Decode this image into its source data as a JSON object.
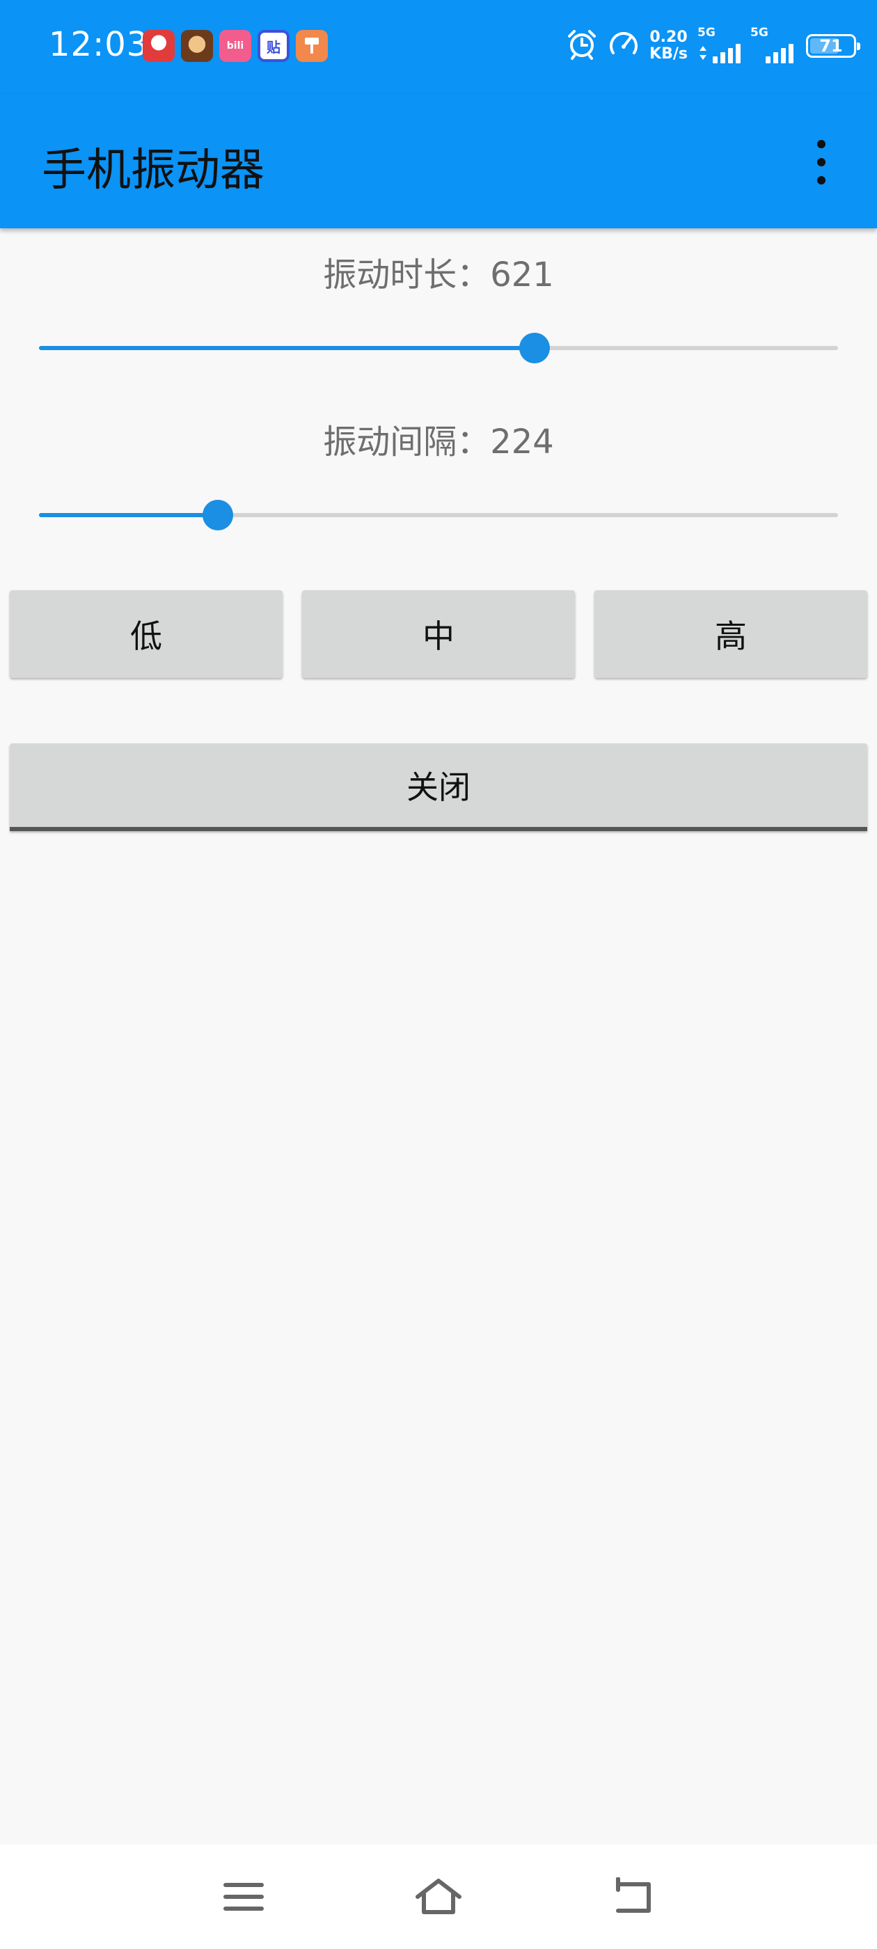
{
  "status_bar": {
    "time": "12:03",
    "notification_icons": [
      "game-app-icon",
      "hero-game-icon",
      "bilibili-icon",
      "tieba-icon",
      "brush-app-icon"
    ],
    "tieba_glyph": "贴",
    "bili_glyph": "bili",
    "speed_value": "0.20",
    "speed_unit": "KB/s",
    "sim1_label": "5G",
    "sim2_label": "5G",
    "battery_level": "71",
    "battery_fraction": 0.71
  },
  "app_bar": {
    "title": "手机振动器"
  },
  "duration": {
    "label": "振动时长：621",
    "fraction": 0.62
  },
  "interval": {
    "label": "振动间隔：224",
    "fraction": 0.224
  },
  "buttons": {
    "low": "低",
    "medium": "中",
    "high": "高",
    "close": "关闭"
  },
  "colors": {
    "primary": "#0b93f6",
    "accent": "#1a8fe3",
    "button_bg": "#d6d7d7",
    "background": "#f8f8f8"
  }
}
